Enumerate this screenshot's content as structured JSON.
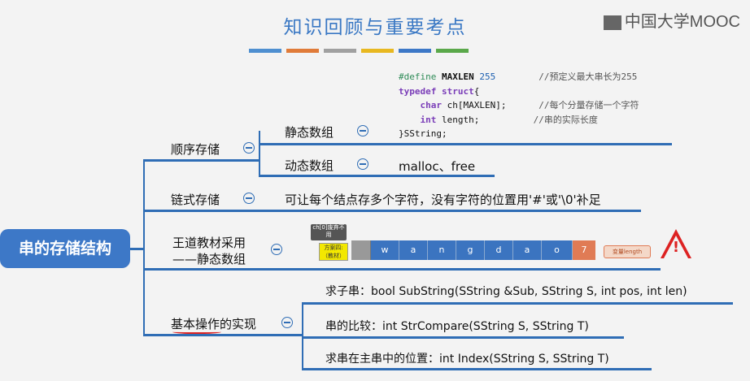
{
  "title": "知识回顾与重要考点",
  "logo": "中国大学MOOC",
  "stripe_colors": [
    "#4f8fd0",
    "#e07b39",
    "#a0a0a0",
    "#e8b820",
    "#3d78c7",
    "#5aa84a"
  ],
  "code": {
    "line1_kw": "#define",
    "line1_name": "MAXLEN",
    "line1_num": "255",
    "line1_comment": "//预定义最大串长为255",
    "line2_kw": "typedef struct",
    "line2_rest": "{",
    "line3_kw": "char",
    "line3_rest": "ch[MAXLEN];",
    "line3_comment": "//每个分量存储一个字符",
    "line4_kw": "int",
    "line4_rest": "length;",
    "line4_comment": "//串的实际长度",
    "line5": "}SString;"
  },
  "root": "串的存储结构",
  "branches": {
    "seq": "顺序存储",
    "static": "静态数组",
    "dynamic": "动态数组",
    "dynamic_desc": "malloc、free",
    "linked": "链式存储",
    "linked_desc": "可让每个结点存多个字符，没有字符的位置用'#'或'\\0'补足",
    "wangdao_1": "王道教材采用",
    "wangdao_2": "——静态数组",
    "ops": "基本操作的实现",
    "op1": "求子串：bool SubString(SString &Sub, SString S, int pos, int len)",
    "op2": "串的比较：int StrCompare(SString S, SString T)",
    "op3": "求串在主串中的位置：int Index(SString S, SString T)"
  },
  "array": {
    "note_ch0": "ch[0]废弃不用",
    "note_plan": "方案四:（教材）",
    "cells": [
      "w",
      "a",
      "n",
      "g",
      "d",
      "a",
      "o"
    ],
    "length": "7",
    "length_label": "变量length",
    "warning": "!"
  }
}
